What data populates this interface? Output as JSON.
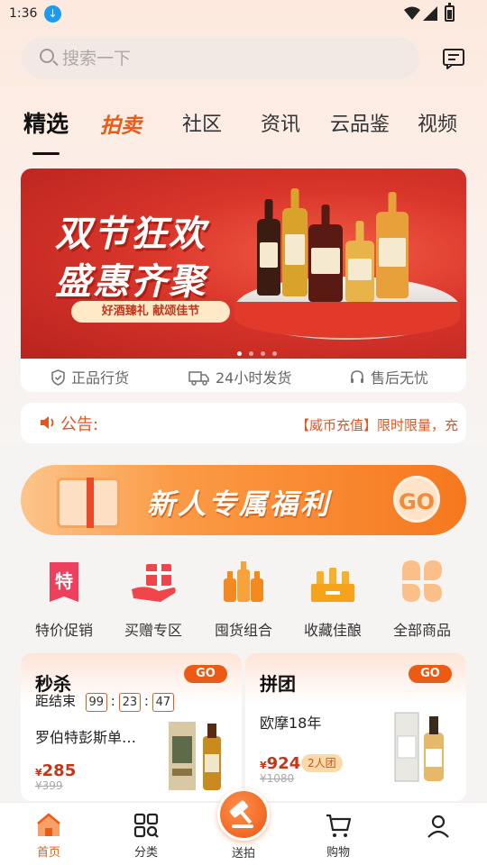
{
  "status_bar": {
    "time": "1:36"
  },
  "search": {
    "placeholder": "搜索一下"
  },
  "tabs": [
    {
      "label": "精选"
    },
    {
      "label": "拍卖"
    },
    {
      "label": "社区"
    },
    {
      "label": "资讯"
    },
    {
      "label": "云品鉴"
    },
    {
      "label": "视频"
    }
  ],
  "banner": {
    "title_line1": "双节狂欢",
    "title_line2": "盛惠齐聚",
    "subtitle": "好酒臻礼 献颂佳节",
    "slide_count": 4,
    "active_slide": 1
  },
  "features": [
    {
      "label": "正品行货",
      "icon": "shield-check-icon"
    },
    {
      "label": "24小时发货",
      "icon": "truck-icon"
    },
    {
      "label": "售后无忧",
      "icon": "headset-icon"
    }
  ],
  "notice": {
    "label": "公告:",
    "text": "【威币充值】限时限量，充"
  },
  "new_user": {
    "title": "新人专属福利",
    "go": "GO"
  },
  "categories": [
    {
      "label": "特价促销",
      "icon": "special-price-icon",
      "glyph": "特"
    },
    {
      "label": "买赠专区",
      "icon": "gift-hand-icon"
    },
    {
      "label": "囤货组合",
      "icon": "bottle-set-icon"
    },
    {
      "label": "收藏佳酿",
      "icon": "wine-crate-icon"
    },
    {
      "label": "全部商品",
      "icon": "clover-grid-icon"
    }
  ],
  "flash_sale": {
    "title": "秒杀",
    "go": "GO",
    "countdown_label": "距结束",
    "hours": "99",
    "minutes": "23",
    "seconds": "47",
    "product": "罗伯特彭斯单…",
    "price_symbol": "¥",
    "price": "285",
    "original_price": "¥399"
  },
  "group_buy": {
    "title": "拼团",
    "go": "GO",
    "product": "欧摩18年",
    "price_symbol": "¥",
    "price": "924",
    "badge": "2人团",
    "original_price": "¥1080"
  },
  "bottom_nav": [
    {
      "label": "首页",
      "icon": "home-icon",
      "active": true
    },
    {
      "label": "分类",
      "icon": "category-grid-icon"
    },
    {
      "label": "送拍",
      "icon": "auction-hammer-icon"
    },
    {
      "label": "购物",
      "icon": "shopping-cart-icon"
    },
    {
      "label": "",
      "icon": "profile-icon"
    }
  ],
  "colors": {
    "accent": "#ec5a14",
    "banner_red": "#d8342a",
    "promo_orange": "#f6781e"
  }
}
